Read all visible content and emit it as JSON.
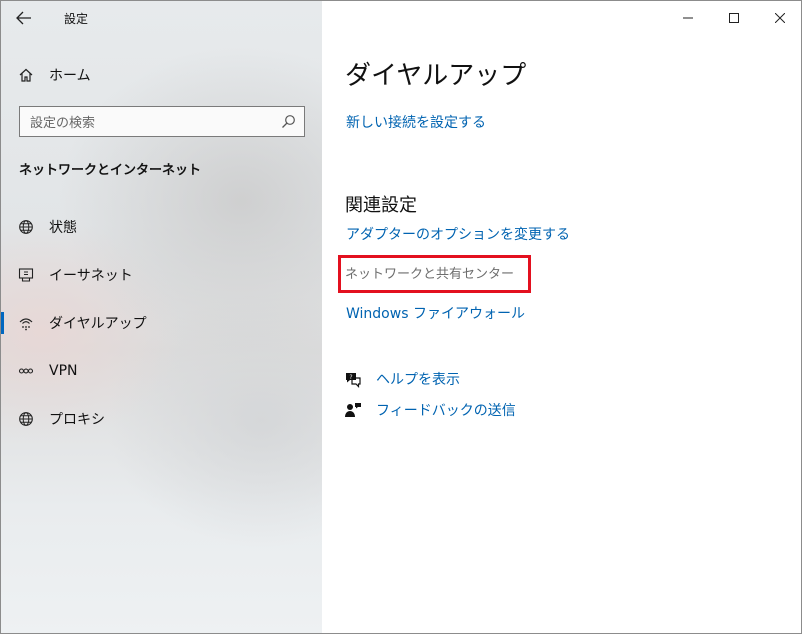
{
  "window": {
    "title": "設定",
    "controls": {
      "minimize": "minimize",
      "maximize": "maximize",
      "close": "close"
    }
  },
  "sidebar": {
    "home_label": "ホーム",
    "search": {
      "placeholder": "設定の検索",
      "value": ""
    },
    "section_title": "ネットワークとインターネット",
    "items": [
      {
        "label": "状態",
        "icon": "globe-icon",
        "selected": false
      },
      {
        "label": "イーサネット",
        "icon": "ethernet-icon",
        "selected": false
      },
      {
        "label": "ダイヤルアップ",
        "icon": "dialup-icon",
        "selected": true
      },
      {
        "label": "VPN",
        "icon": "vpn-icon",
        "selected": false
      },
      {
        "label": "プロキシ",
        "icon": "globe-icon",
        "selected": false
      }
    ]
  },
  "main": {
    "title": "ダイヤルアップ",
    "new_connection_link": "新しい接続を設定する",
    "related_heading": "関連設定",
    "related_links": {
      "adapter_options": "アダプターのオプションを変更する",
      "network_sharing_center": "ネットワークと共有センター",
      "windows_firewall": "Windows ファイアウォール"
    },
    "help": {
      "show_help": "ヘルプを表示",
      "send_feedback": "フィードバックの送信"
    }
  },
  "colors": {
    "accent": "#0067c0",
    "link": "#0063b1",
    "highlight": "#e3101f"
  }
}
